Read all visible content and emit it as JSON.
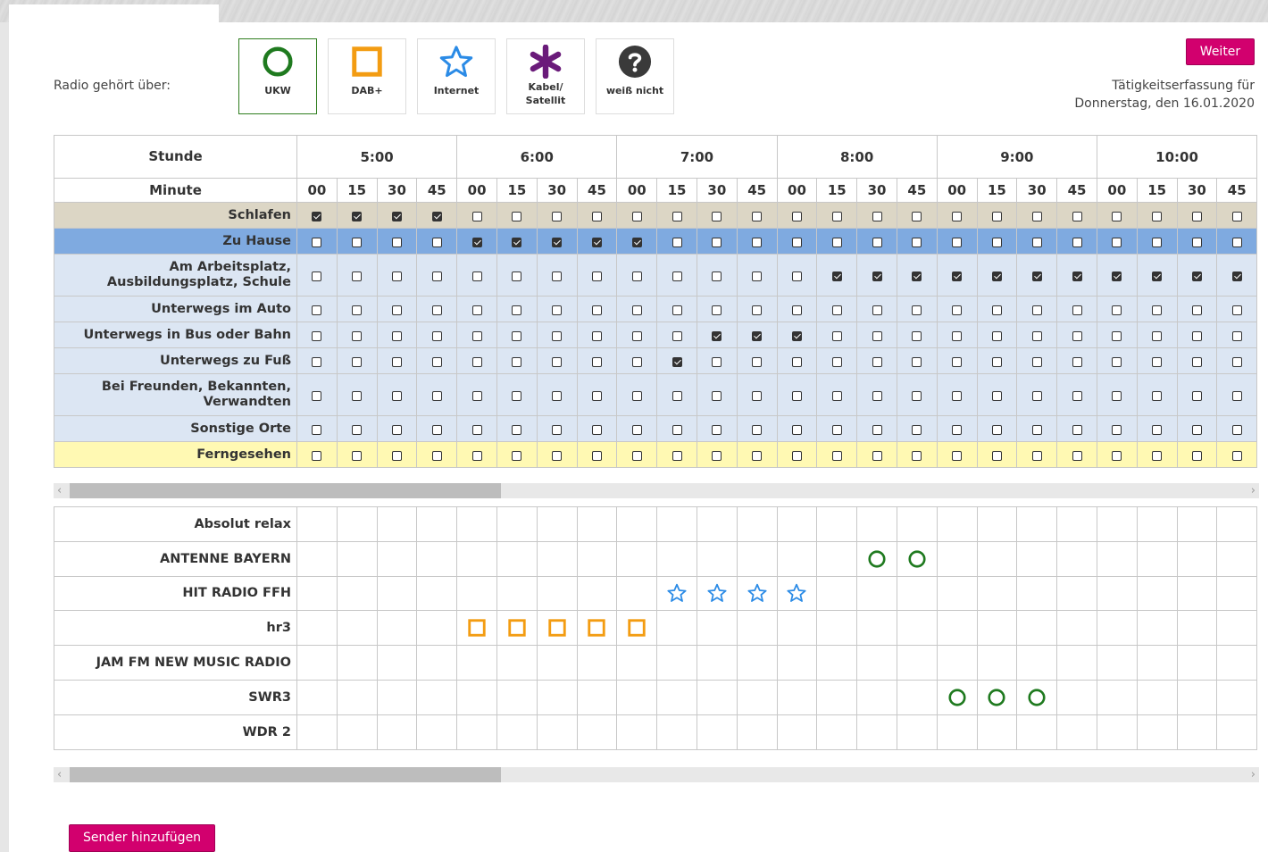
{
  "legend": {
    "label": "Radio gehört über:",
    "sources": [
      {
        "key": "ukw",
        "label": "UKW",
        "icon": "circle-icon",
        "color": "#1f7a1f"
      },
      {
        "key": "dab",
        "label": "DAB+",
        "icon": "square-icon",
        "color": "#f39c12"
      },
      {
        "key": "internet",
        "label": "Internet",
        "icon": "star-icon",
        "color": "#2b8be6"
      },
      {
        "key": "kabel",
        "label": "Kabel/ Satellit",
        "label_line1": "Kabel/",
        "label_line2": "Satellit",
        "icon": "asterisk-icon",
        "color": "#6a1b7a"
      },
      {
        "key": "weiss",
        "label": "weiß nicht",
        "icon": "question-icon",
        "color": "#3a3a3a"
      }
    ]
  },
  "header": {
    "next_button": "Weiter",
    "date_line1": "Tätigkeitserfassung für",
    "date_line2": "Donnerstag, den 16.01.2020"
  },
  "activity": {
    "hour_label": "Stunde",
    "minute_label": "Minute",
    "hours": [
      "5:00",
      "6:00",
      "7:00",
      "8:00",
      "9:00",
      "10:00"
    ],
    "minutes": [
      "00",
      "15",
      "30",
      "45"
    ],
    "rows": [
      {
        "label": "Schlafen",
        "style": "sleep",
        "checked": [
          0,
          1,
          2,
          3
        ]
      },
      {
        "label": "Zu Hause",
        "style": "home",
        "checked": [
          4,
          5,
          6,
          7,
          8
        ]
      },
      {
        "label": "Am Arbeitsplatz, Ausbildungsplatz, Schule",
        "style": "out",
        "tall": true,
        "checked": [
          13,
          14,
          15,
          16,
          17,
          18,
          19,
          20,
          21,
          22,
          23
        ]
      },
      {
        "label": "Unterwegs im Auto",
        "style": "out",
        "checked": []
      },
      {
        "label": "Unterwegs in Bus oder Bahn",
        "style": "out",
        "checked": [
          10,
          11,
          12
        ]
      },
      {
        "label": "Unterwegs zu Fuß",
        "style": "out",
        "checked": [
          9
        ]
      },
      {
        "label": "Bei Freunden, Bekannten, Verwandten",
        "style": "out",
        "tall": true,
        "checked": []
      },
      {
        "label": "Sonstige Orte",
        "style": "out",
        "checked": []
      },
      {
        "label": "Ferngesehen",
        "style": "tv",
        "checked": []
      }
    ]
  },
  "stations": [
    {
      "name": "Absolut relax",
      "marks": []
    },
    {
      "name": "ANTENNE BAYERN",
      "marks": [
        {
          "col": 14,
          "type": "ukw"
        },
        {
          "col": 15,
          "type": "ukw"
        }
      ]
    },
    {
      "name": "HIT RADIO FFH",
      "marks": [
        {
          "col": 9,
          "type": "internet"
        },
        {
          "col": 10,
          "type": "internet"
        },
        {
          "col": 11,
          "type": "internet"
        },
        {
          "col": 12,
          "type": "internet"
        }
      ]
    },
    {
      "name": "hr3",
      "marks": [
        {
          "col": 4,
          "type": "dab"
        },
        {
          "col": 5,
          "type": "dab"
        },
        {
          "col": 6,
          "type": "dab"
        },
        {
          "col": 7,
          "type": "dab"
        },
        {
          "col": 8,
          "type": "dab"
        }
      ]
    },
    {
      "name": "JAM FM NEW MUSIC RADIO",
      "marks": []
    },
    {
      "name": "SWR3",
      "marks": [
        {
          "col": 16,
          "type": "ukw"
        },
        {
          "col": 17,
          "type": "ukw"
        },
        {
          "col": 18,
          "type": "ukw"
        }
      ]
    },
    {
      "name": "WDR 2",
      "marks": []
    }
  ],
  "add_station_button": "Sender hinzufügen",
  "scroll_arrows": {
    "left": "‹",
    "right": "›"
  }
}
